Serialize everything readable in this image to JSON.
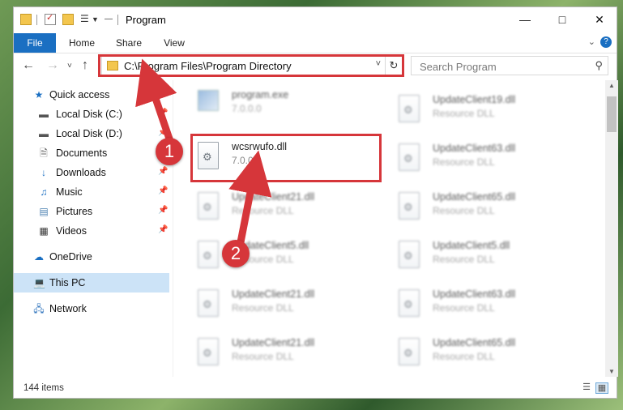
{
  "window": {
    "title": "Program",
    "minimize_glyph": "—",
    "maximize_glyph": "□",
    "close_glyph": "✕"
  },
  "ribbon": {
    "tabs": [
      "File",
      "Home",
      "Share",
      "View"
    ],
    "expand_glyph": "⌄",
    "help_glyph": "?"
  },
  "nav": {
    "back": "←",
    "forward": "→",
    "recent": "˅",
    "up": "↑"
  },
  "address": {
    "path": "C:\\Program Files\\Program Directory",
    "dropdown_glyph": "˅",
    "refresh_glyph": "↻"
  },
  "search": {
    "placeholder": "Search Program",
    "icon": "search-icon"
  },
  "navpane": {
    "items": [
      {
        "label": "Quick access",
        "icon": "star-icon",
        "pinned": false
      },
      {
        "label": "Local Disk (C:)",
        "icon": "drive-icon",
        "pinned": true
      },
      {
        "label": "Local Disk (D:)",
        "icon": "drive-icon",
        "pinned": true
      },
      {
        "label": "Documents",
        "icon": "documents-icon",
        "pinned": true
      },
      {
        "label": "Downloads",
        "icon": "downloads-icon",
        "pinned": true
      },
      {
        "label": "Music",
        "icon": "music-icon",
        "pinned": true
      },
      {
        "label": "Pictures",
        "icon": "pictures-icon",
        "pinned": true
      },
      {
        "label": "Videos",
        "icon": "videos-icon",
        "pinned": true
      },
      {
        "label": "OneDrive",
        "icon": "cloud-icon",
        "pinned": false
      },
      {
        "label": "This PC",
        "icon": "computer-icon",
        "pinned": false,
        "selected": true
      },
      {
        "label": "Network",
        "icon": "network-icon",
        "pinned": false
      }
    ]
  },
  "files": {
    "left": [
      {
        "name": "program.exe",
        "desc": "7.0.0.0",
        "blurred": true
      },
      {
        "name": "wcsrwufo.dll",
        "desc": "7.0.0.0",
        "blurred": false
      },
      {
        "name": "UpdateClient21.dll",
        "desc": "Resource DLL",
        "blurred": true
      },
      {
        "name": "UpdateClient5.dll",
        "desc": "Resource DLL",
        "blurred": true
      },
      {
        "name": "UpdateClient21.dll",
        "desc": "Resource DLL",
        "blurred": true
      },
      {
        "name": "UpdateClient21.dll",
        "desc": "Resource DLL",
        "blurred": true
      }
    ],
    "right": [
      {
        "name": "UpdateClient19.dll",
        "desc": "Resource DLL",
        "blurred": true
      },
      {
        "name": "UpdateClient63.dll",
        "desc": "Resource DLL",
        "blurred": true
      },
      {
        "name": "UpdateClient65.dll",
        "desc": "Resource DLL",
        "blurred": true
      },
      {
        "name": "UpdateClient5.dll",
        "desc": "Resource DLL",
        "blurred": true
      },
      {
        "name": "UpdateClient63.dll",
        "desc": "Resource DLL",
        "blurred": true
      },
      {
        "name": "UpdateClient65.dll",
        "desc": "Resource DLL",
        "blurred": true
      }
    ]
  },
  "status": {
    "item_count": "144 items"
  },
  "annotations": {
    "step1": "1",
    "step2": "2",
    "color": "#d6363a"
  }
}
